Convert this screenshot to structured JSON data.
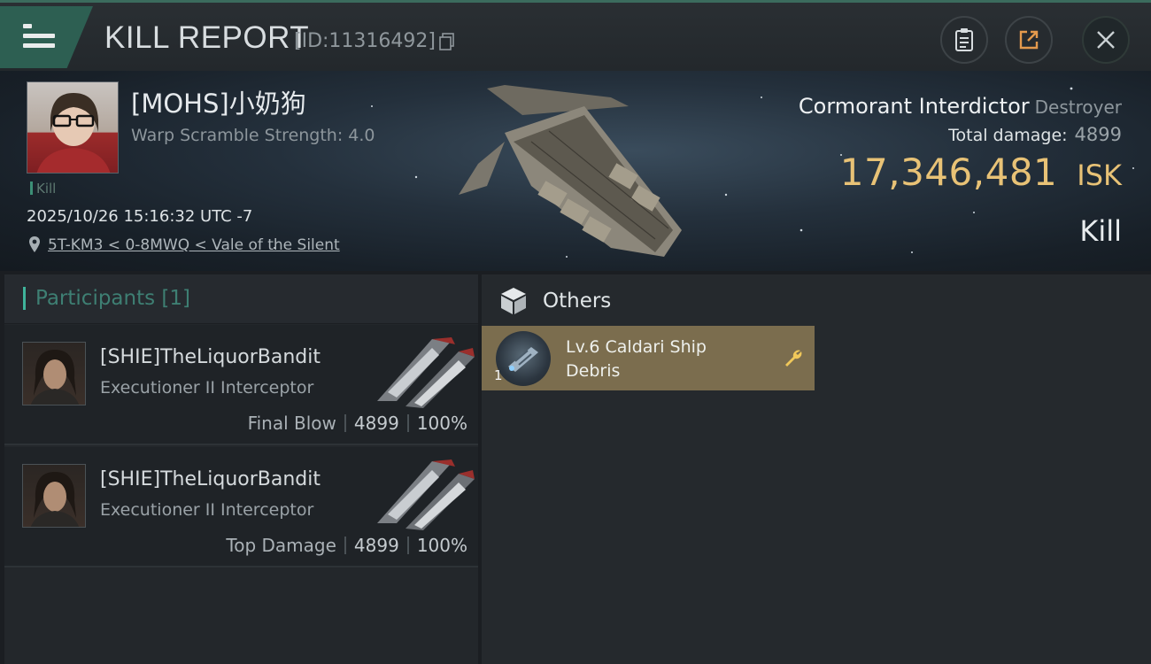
{
  "header": {
    "title": "KILL REPORT",
    "report_id": "[ID:11316492]",
    "icons": [
      "menu-icon",
      "copy-icon",
      "clipboard-icon",
      "share-icon",
      "close-icon"
    ]
  },
  "victim": {
    "name": "[MOHS]小奶狗",
    "warp_scramble": "Warp Scramble Strength: 4.0",
    "tag": "Kill",
    "timestamp": "2025/10/26 15:16:32 UTC -7",
    "location": "5T-KM3 < 0-8MWQ < Vale of the Silent",
    "ship_name": "Cormorant Interdictor",
    "ship_class": "Destroyer",
    "total_damage_label": "Total damage:",
    "total_damage": "4899",
    "isk_value": "17,346,481",
    "isk_unit": "ISK",
    "result": "Kill"
  },
  "participants": {
    "title": "Participants [1]",
    "rows": [
      {
        "name": "[SHIE]TheLiquorBandit",
        "ship": "Executioner II Interceptor",
        "role": "Final Blow",
        "damage": "4899",
        "percent": "100%"
      },
      {
        "name": "[SHIE]TheLiquorBandit",
        "ship": "Executioner II Interceptor",
        "role": "Top Damage",
        "damage": "4899",
        "percent": "100%"
      }
    ]
  },
  "others": {
    "title": "Others",
    "items": [
      {
        "name": "Lv.6 Caldari Ship Debris",
        "quantity": "1"
      }
    ]
  },
  "colors": {
    "accent_teal": "#3fb39a",
    "isk_gold": "#e8c276",
    "item_card": "#7b6d4e"
  }
}
